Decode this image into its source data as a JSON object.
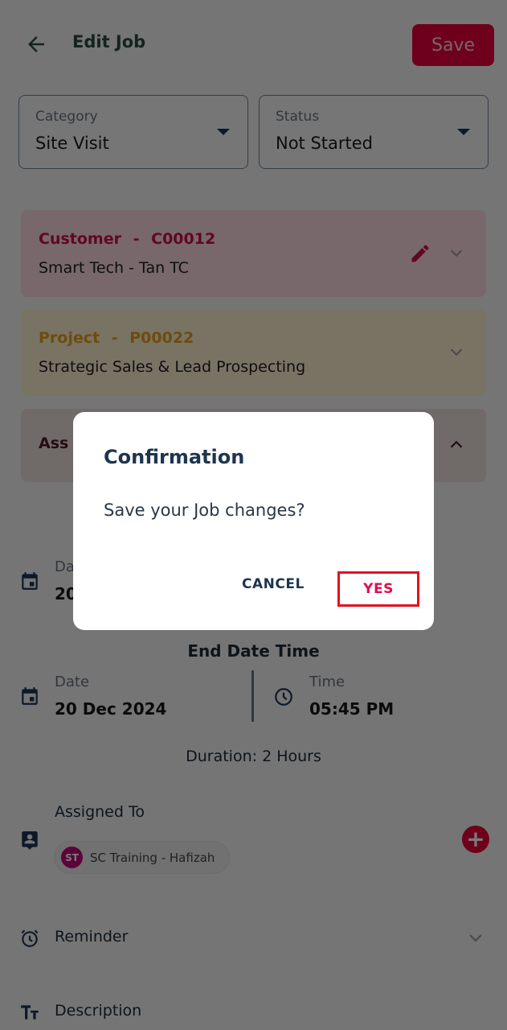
{
  "header": {
    "title": "Edit Job",
    "save_label": "Save",
    "back_icon": "arrow-left-icon"
  },
  "fields": {
    "category": {
      "label": "Category",
      "value": "Site Visit"
    },
    "status": {
      "label": "Status",
      "value": "Not Started"
    }
  },
  "cards": {
    "customer": {
      "label": "Customer",
      "separator": "-",
      "code": "C00012",
      "name": "Smart Tech - Tan TC"
    },
    "project": {
      "label": "Project",
      "separator": "-",
      "code": "P00022",
      "name": "Strategic Sales & Lead Prospecting"
    },
    "assignment": {
      "label_visible": "Ass"
    }
  },
  "start": {
    "date_label": "Da",
    "date_value": "20"
  },
  "end": {
    "title": "End Date Time",
    "date_label": "Date",
    "date_value": "20 Dec 2024",
    "time_label": "Time",
    "time_value": "05:45 PM"
  },
  "duration": "Duration: 2 Hours",
  "assigned": {
    "label": "Assigned To",
    "chips": [
      {
        "initials": "ST",
        "name": "SC Training - Hafizah"
      }
    ]
  },
  "reminder": {
    "label": "Reminder"
  },
  "description": {
    "label": "Description"
  },
  "dialog": {
    "title": "Confirmation",
    "message": "Save your Job changes?",
    "cancel_label": "CANCEL",
    "yes_label": "YES"
  },
  "colors": {
    "brand": "#e8003b",
    "customer_accent": "#c8104d",
    "project_accent": "#e4a01a",
    "highlight_box": "#e3111f"
  }
}
